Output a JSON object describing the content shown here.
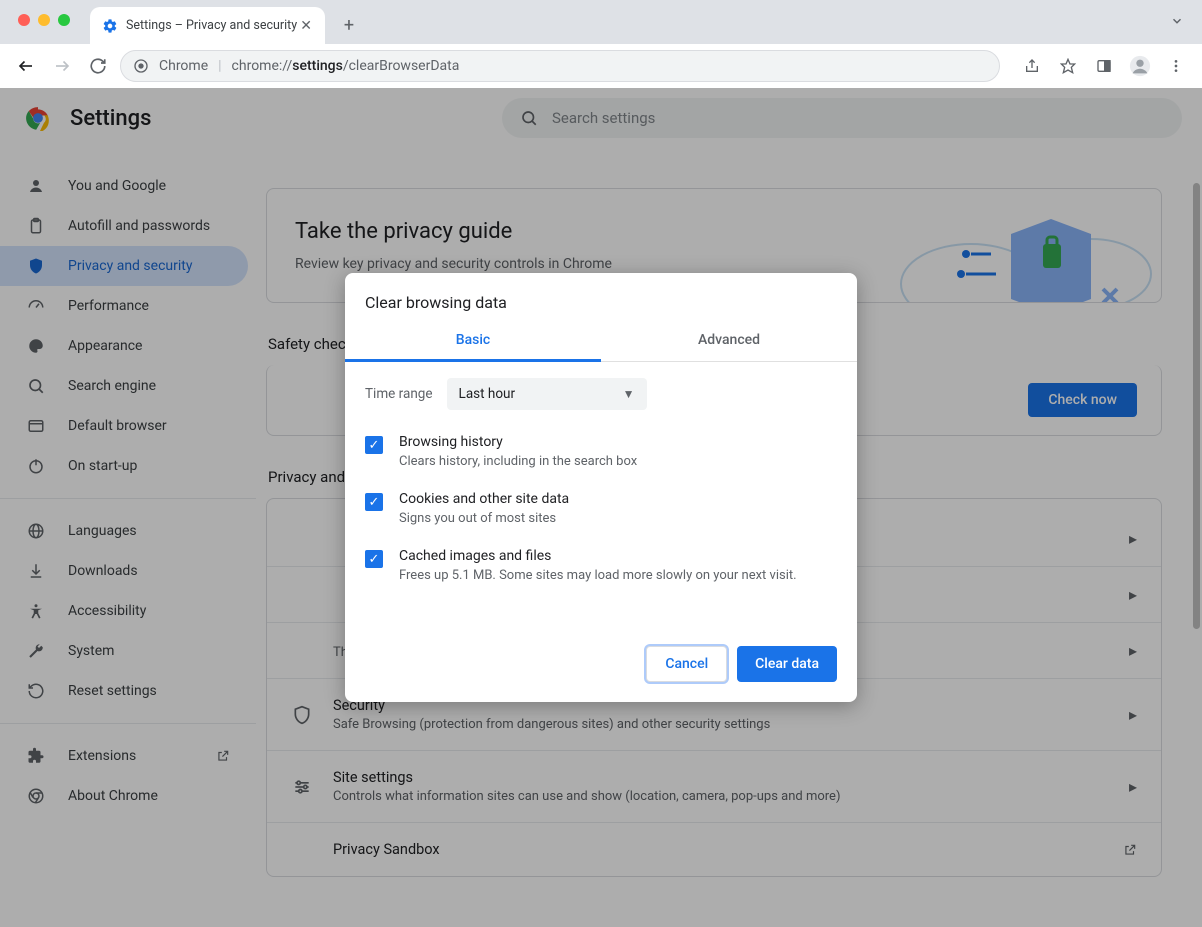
{
  "window": {
    "tab_title": "Settings – Privacy and security",
    "chrome_label": "Chrome",
    "url_prefix": "chrome://",
    "url_bold": "settings",
    "url_rest": "/clearBrowserData"
  },
  "header": {
    "title": "Settings",
    "search_placeholder": "Search settings"
  },
  "sidebar": {
    "items": [
      {
        "label": "You and Google"
      },
      {
        "label": "Autofill and passwords"
      },
      {
        "label": "Privacy and security"
      },
      {
        "label": "Performance"
      },
      {
        "label": "Appearance"
      },
      {
        "label": "Search engine"
      },
      {
        "label": "Default browser"
      },
      {
        "label": "On start-up"
      }
    ],
    "advanced": [
      {
        "label": "Languages"
      },
      {
        "label": "Downloads"
      },
      {
        "label": "Accessibility"
      },
      {
        "label": "System"
      },
      {
        "label": "Reset settings"
      }
    ],
    "footer": [
      {
        "label": "Extensions"
      },
      {
        "label": "About Chrome"
      }
    ]
  },
  "privacy_guide": {
    "title": "Take the privacy guide",
    "subtitle": "Review key privacy and security controls in Chrome"
  },
  "safety_check": {
    "section": "Safety check",
    "check_now": "Check now"
  },
  "privacy_section_title": "Privacy and security",
  "rows": [
    {
      "title": "Third-party cookies are blocked in Incognito mode",
      "subtitle": ""
    },
    {
      "title": "Security",
      "subtitle": "Safe Browsing (protection from dangerous sites) and other security settings"
    },
    {
      "title": "Site settings",
      "subtitle": "Controls what information sites can use and show (location, camera, pop-ups and more)"
    },
    {
      "title": "Privacy Sandbox",
      "subtitle": ""
    }
  ],
  "dialog": {
    "title": "Clear browsing data",
    "tabs": {
      "basic": "Basic",
      "advanced": "Advanced"
    },
    "time_range_label": "Time range",
    "time_range_value": "Last hour",
    "checks": [
      {
        "title": "Browsing history",
        "desc": "Clears history, including in the search box"
      },
      {
        "title": "Cookies and other site data",
        "desc": "Signs you out of most sites"
      },
      {
        "title": "Cached images and files",
        "desc": "Frees up 5.1 MB. Some sites may load more slowly on your next visit."
      }
    ],
    "cancel": "Cancel",
    "clear": "Clear data"
  }
}
